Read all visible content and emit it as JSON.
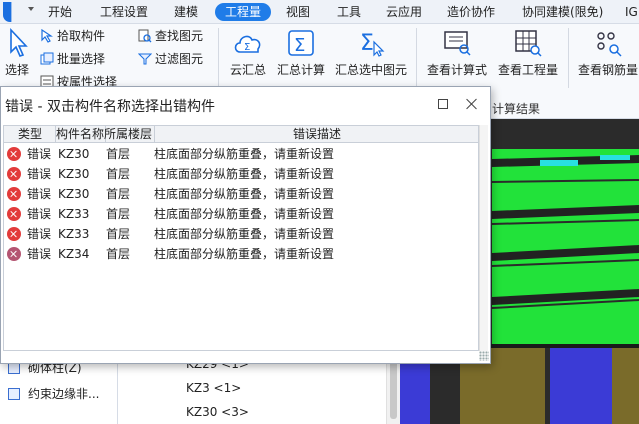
{
  "menu": {
    "tabs": [
      "开始",
      "工程设置",
      "建模",
      "工程量",
      "视图",
      "工具",
      "云应用",
      "造价协作",
      "协同建模(限免)",
      "IG"
    ],
    "active_tab": "工程量"
  },
  "ribbon": {
    "select_label": "选择",
    "pick_component": "拾取构件",
    "batch_select": "批量选择",
    "select_by_attr": "按属性选择",
    "find_element": "查找图元",
    "filter_element": "过滤图元",
    "cloud_summary": "云汇总",
    "summary_calc": "汇总计算",
    "summary_selected": "汇总选中图元",
    "view_formula": "查看计算式",
    "view_quantity": "查看工程量",
    "view_rebar": "查看钢筋量",
    "calc_result_label": "计算结果"
  },
  "dialog": {
    "title": "错误 - 双击构件名称选择出错构件",
    "columns": [
      "类型",
      "构件名称",
      "所属楼层",
      "错误描述"
    ],
    "rows": [
      {
        "type": "错误",
        "name": "KZ30",
        "floor": "首层",
        "desc": "柱底面部分纵筋重叠，请重新设置"
      },
      {
        "type": "错误",
        "name": "KZ30",
        "floor": "首层",
        "desc": "柱底面部分纵筋重叠，请重新设置"
      },
      {
        "type": "错误",
        "name": "KZ30",
        "floor": "首层",
        "desc": "柱底面部分纵筋重叠，请重新设置"
      },
      {
        "type": "错误",
        "name": "KZ33",
        "floor": "首层",
        "desc": "柱底面部分纵筋重叠，请重新设置"
      },
      {
        "type": "错误",
        "name": "KZ33",
        "floor": "首层",
        "desc": "柱底面部分纵筋重叠，请重新设置"
      },
      {
        "type": "错误",
        "name": "KZ34",
        "floor": "首层",
        "desc": "柱底面部分纵筋重叠，请重新设置"
      }
    ]
  },
  "left_panel": {
    "items": [
      "砌体柱(Z)",
      "约束边缘非..."
    ]
  },
  "tree": {
    "items": [
      "KZ29 <1>",
      "KZ3 <1>",
      "KZ30 <3>"
    ]
  },
  "colors": {
    "accent": "#1f7ce8",
    "error": "#e23b3b",
    "viewport_green": "#22e23a",
    "viewport_blue": "#3b3bd6"
  }
}
